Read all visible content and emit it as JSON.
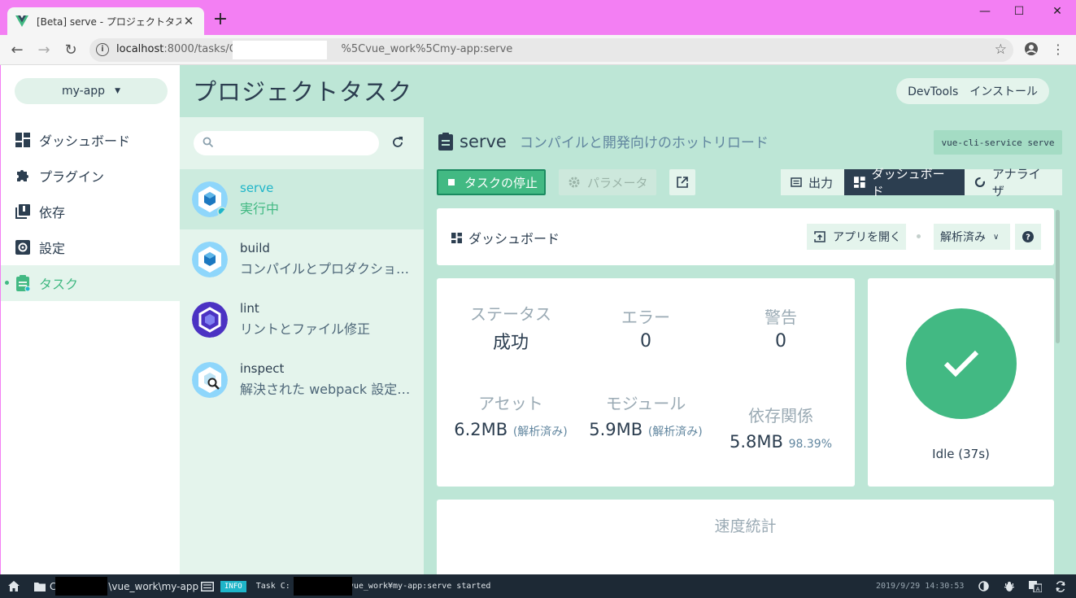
{
  "browser": {
    "tab_title": "[Beta] serve - プロジェクトタスク - Vue",
    "url_host": "localhost",
    "url_rest": ":8000/tasks/C:%",
    "url_tail": "%5Cvue_work%5Cmy-app:serve"
  },
  "sidebar": {
    "project": "my-app",
    "items": [
      {
        "label": "ダッシュボード",
        "icon": "dashboard-icon"
      },
      {
        "label": "プラグイン",
        "icon": "puzzle-icon"
      },
      {
        "label": "依存",
        "icon": "library-icon"
      },
      {
        "label": "設定",
        "icon": "gear-icon"
      },
      {
        "label": "タスク",
        "icon": "clipboard-icon"
      }
    ]
  },
  "header": {
    "title": "プロジェクトタスク",
    "devtools_label": "DevTools　インストール"
  },
  "tasks": [
    {
      "name": "serve",
      "desc": "実行中"
    },
    {
      "name": "build",
      "desc": "コンパイルとプロダクション用の最小化"
    },
    {
      "name": "lint",
      "desc": "リントとファイル修正"
    },
    {
      "name": "inspect",
      "desc": "解決された webpack 設定を検査"
    }
  ],
  "main": {
    "task_title": "serve",
    "task_subtitle": "コンパイルと開発向けのホットリロード",
    "command": "vue-cli-service serve",
    "stop_label": "タスクの停止",
    "params_label": "パラメータ",
    "views": {
      "output": "出力",
      "dashboard": "ダッシュボード",
      "analyzer": "アナライザ"
    },
    "dashboard_title": "ダッシュボード",
    "open_app_label": "アプリを開く",
    "analyzed_label": "解析済み",
    "stats": {
      "status_label": "ステータス",
      "status_value": "成功",
      "errors_label": "エラー",
      "errors_value": "0",
      "warnings_label": "警告",
      "warnings_value": "0",
      "assets_label": "アセット",
      "assets_value": "6.2MB",
      "assets_note": "(解析済み)",
      "modules_label": "モジュール",
      "modules_value": "5.9MB",
      "modules_note": "(解析済み)",
      "deps_label": "依存関係",
      "deps_value": "5.8MB",
      "deps_pct": "98.39%"
    },
    "idle_text": "Idle (37s)",
    "speed_title": "速度統計"
  },
  "statusbar": {
    "cwd_prefix": "C",
    "cwd_suffix": "\\vue_work\\my-app",
    "log_level": "INFO",
    "log_prefix": "Task C:",
    "log_suffix": "vue_work¥my-app:serve started",
    "timestamp": "2019/9/29 14:30:53"
  },
  "colors": {
    "accent": "#42b983",
    "background": "#bde6d6",
    "dark": "#2c3e50",
    "titlebar": "#f37ff3"
  }
}
